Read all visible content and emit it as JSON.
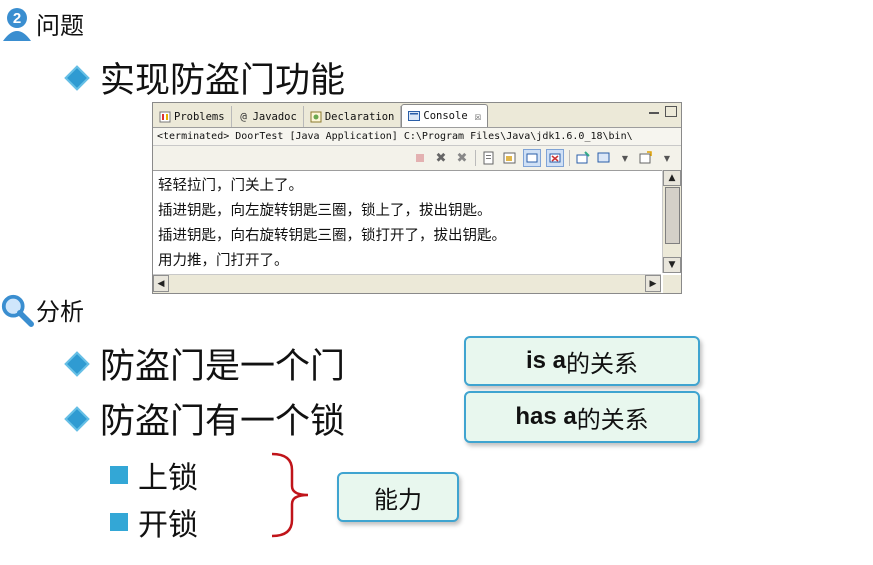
{
  "question": {
    "label": "问题",
    "icon": "question-number-2-icon"
  },
  "bullet1": "实现防盗门功能",
  "eclipse": {
    "tabs": [
      {
        "label": "Problems",
        "icon": "problems-icon"
      },
      {
        "label": "Javadoc",
        "icon": "at-icon"
      },
      {
        "label": "Declaration",
        "icon": "declaration-icon"
      },
      {
        "label": "Console",
        "icon": "console-icon",
        "close": "☒"
      }
    ],
    "terminated_line": "<terminated> DoorTest [Java Application] C:\\Program Files\\Java\\jdk1.6.0_18\\bin\\",
    "console_lines": [
      "轻轻拉门，门关上了。",
      "插进钥匙，向左旋转钥匙三圈，锁上了，拔出钥匙。",
      "插进钥匙，向右旋转钥匙三圈，锁打开了，拔出钥匙。",
      "用力推，门打开了。"
    ]
  },
  "analysis": {
    "label": "分析",
    "icon": "magnifier-icon"
  },
  "bullets2": [
    "防盗门是一个门",
    "防盗门有一个锁"
  ],
  "subbullets": [
    "上锁",
    "开锁"
  ],
  "callouts": {
    "isa_en": "is a",
    "isa_cn": "的关系",
    "hasa_en": "has a",
    "hasa_cn": "的关系",
    "ability": "能力"
  },
  "colors": {
    "accent": "#2f9bd2",
    "callout_bg": "#e8f7ee",
    "callout_border": "#3fa4d0",
    "brace": "#c0141a"
  }
}
